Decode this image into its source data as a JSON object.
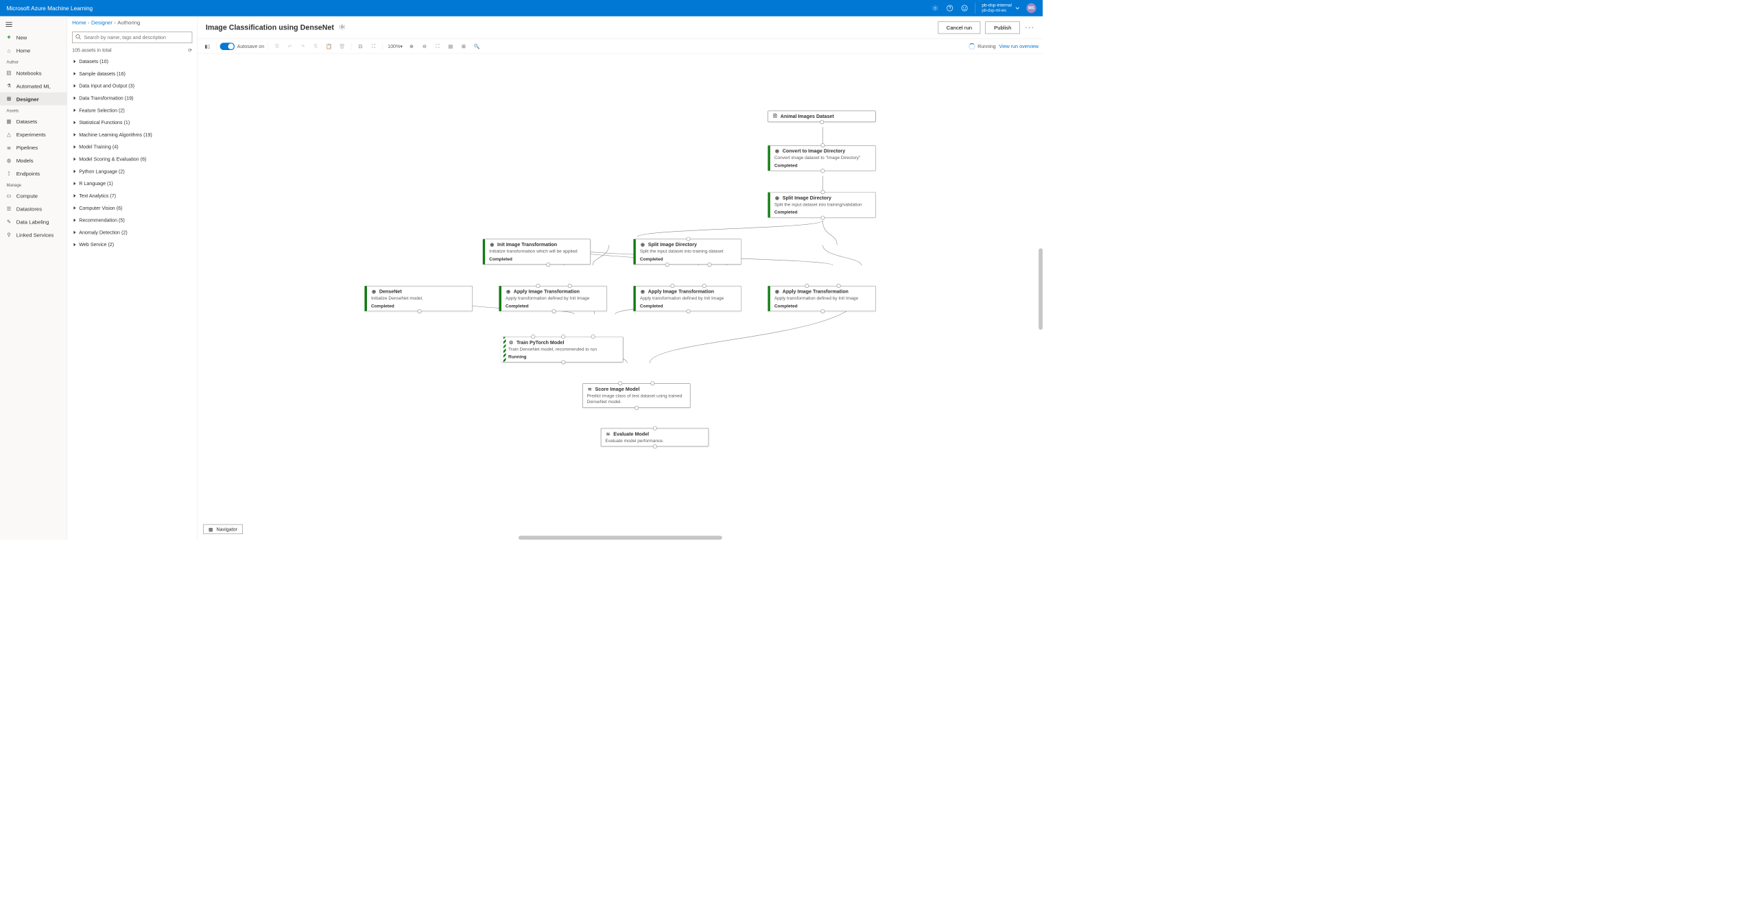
{
  "topbar": {
    "title": "Microsoft Azure Machine Learning",
    "workspace": "pb-dsp-internal",
    "workspace_sub": "pb-dsp-ml-ws",
    "avatar": "MS"
  },
  "leftnav": {
    "new": "New",
    "home": "Home",
    "sect_author": "Author",
    "notebooks": "Notebooks",
    "automl": "Automated ML",
    "designer": "Designer",
    "sect_assets": "Assets",
    "datasets": "Datasets",
    "experiments": "Experiments",
    "pipelines": "Pipelines",
    "models": "Models",
    "endpoints": "Endpoints",
    "sect_manage": "Manage",
    "compute": "Compute",
    "datastores": "Datastores",
    "datalabeling": "Data Labeling",
    "linked": "Linked Services"
  },
  "breadcrumb": {
    "home": "Home",
    "designer": "Designer",
    "authoring": "Authoring"
  },
  "search": {
    "placeholder": "Search by name, tags and description"
  },
  "assets": {
    "count": "105 assets in total",
    "cats": [
      "Datasets (10)",
      "Sample datasets (16)",
      "Data Input and Output (3)",
      "Data Transformation (19)",
      "Feature Selection (2)",
      "Statistical Functions (1)",
      "Machine Learning Algorithms (19)",
      "Model Training (4)",
      "Model Scoring & Evaluation (6)",
      "Python Language (2)",
      "R Language (1)",
      "Text Analytics (7)",
      "Computer Vision (6)",
      "Recommendation (5)",
      "Anomaly Detection (2)",
      "Web Service (2)"
    ]
  },
  "header": {
    "title": "Image Classification using DenseNet",
    "cancel": "Cancel run",
    "publish": "Publish"
  },
  "toolbar": {
    "autosave": "Autosave on",
    "zoom": "100%",
    "running": "Running",
    "overview": "View run overview"
  },
  "nodes": {
    "n1": {
      "title": "Animal Images Dataset"
    },
    "n2": {
      "title": "Convert to Image Directory",
      "desc": "Convert image dataset to \"Image Directory\"",
      "status": "Completed"
    },
    "n3": {
      "title": "Split Image Directory",
      "desc": "Split the input dataset into training/validation",
      "status": "Completed"
    },
    "n4": {
      "title": "Init Image Transformation",
      "desc": "Initialize transformation which will be applied",
      "status": "Completed"
    },
    "n5": {
      "title": "Split Image Directory",
      "desc": "Split the input dataset into training dataset",
      "status": "Completed"
    },
    "n6": {
      "title": "DenseNet",
      "desc": "Initialize DenseNet model.",
      "status": "Completed"
    },
    "n7": {
      "title": "Apply Image Transformation",
      "desc": "Apply transformation defined by Init Image",
      "status": "Completed"
    },
    "n8": {
      "title": "Apply Image Transformation",
      "desc": "Apply transformation defined by Init Image",
      "status": "Completed"
    },
    "n9": {
      "title": "Apply Image Transformation",
      "desc": "Apply transformation defined by Init Image",
      "status": "Completed"
    },
    "n10": {
      "title": "Train PyTorch Model",
      "desc": "Train DenseNet model, recommended to run",
      "status": "Running"
    },
    "n11": {
      "title": "Score Image Model",
      "desc": "Predict image class of test dataset using trained DenseNet model."
    },
    "n12": {
      "title": "Evaluate Model",
      "desc": "Evaluate model performance."
    }
  },
  "navigator": "Navigator"
}
